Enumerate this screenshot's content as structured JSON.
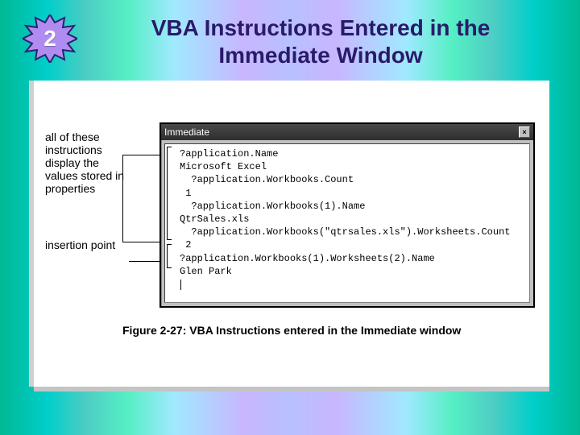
{
  "badge": {
    "number": "2"
  },
  "title": "VBA Instructions Entered in the Immediate Window",
  "annotations": {
    "block": "all of these instructions display the values stored in properties",
    "insertion": "insertion point"
  },
  "immediate": {
    "title": "Immediate",
    "close": "×",
    "lines": [
      "?application.Name",
      "Microsoft Excel",
      "  ?application.Workbooks.Count",
      " 1",
      "  ?application.Workbooks(1).Name",
      "QtrSales.xls",
      "  ?application.Workbooks(\"qtrsales.xls\").Worksheets.Count",
      " 2",
      "?application.Workbooks(1).Worksheets(2).Name",
      "Glen Park"
    ]
  },
  "caption": "Figure 2-27:  VBA Instructions entered in the Immediate window"
}
